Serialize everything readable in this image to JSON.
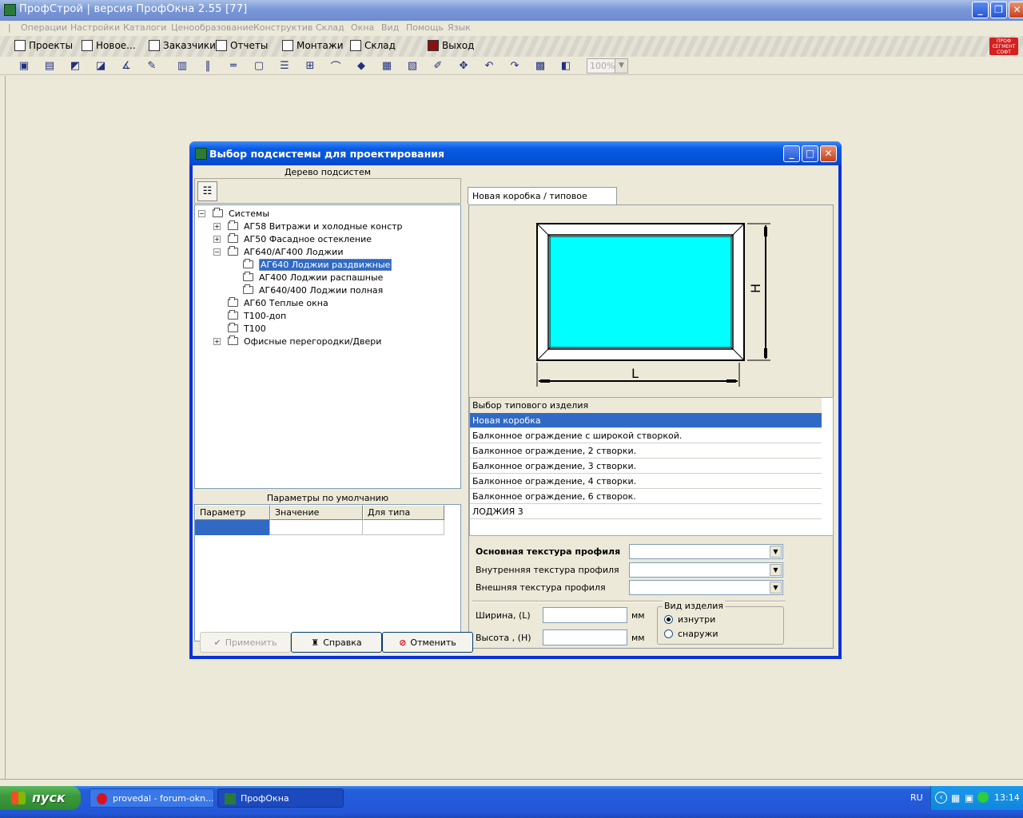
{
  "app": {
    "title": "ПрофСтрой | версия ПрофОкна  2.55 [77]"
  },
  "menu": [
    "Операции",
    "Настройки",
    "Каталоги",
    "Ценообразование",
    "Конструктив",
    "Склад",
    "Окна",
    "Вид",
    "Помощь",
    "Язык"
  ],
  "toolbar1": {
    "projects": "Проекты",
    "new": "Новое...",
    "customers": "Заказчики",
    "reports": "Отчеты",
    "installs": "Монтажи",
    "warehouse": "Склад",
    "exit": "Выход",
    "brand": [
      "ПРОФ",
      "СЕГМЕНТ",
      "СОФТ"
    ]
  },
  "toolbar2": {
    "zoom": "100%"
  },
  "dialog": {
    "title": "Выбор подсистемы для проектирования",
    "tree_header": "Дерево  подсистем",
    "tree": [
      {
        "label": "Системы",
        "level": 0,
        "expander": "−"
      },
      {
        "label": "АГ58  Витражи и холодные констр",
        "level": 1,
        "expander": "+"
      },
      {
        "label": "АГ50 Фасадное остекление",
        "level": 1,
        "expander": "+"
      },
      {
        "label": "АГ640/АГ400 Лоджии",
        "level": 1,
        "expander": "−"
      },
      {
        "label": "АГ640 Лоджии раздвижные",
        "level": 2,
        "selected": true
      },
      {
        "label": "АГ400 Лоджии распашные",
        "level": 2
      },
      {
        "label": "АГ640/400 Лоджии полная",
        "level": 2
      },
      {
        "label": "АГ60 Теплые  окна",
        "level": 1
      },
      {
        "label": "Т100-доп",
        "level": 1
      },
      {
        "label": "Т100",
        "level": 1
      },
      {
        "label": "Офисные перегородки/Двери",
        "level": 1,
        "expander": "+"
      }
    ],
    "params_header": "Параметры по умолчанию",
    "params_columns": [
      "Параметр",
      "Значение",
      "Для типа"
    ],
    "tab_label": "Новая коробка / типовое изделие",
    "preview": {
      "h_label": "H",
      "l_label": "L",
      "glass_color": "#00ffff"
    },
    "typical_header": "Выбор типового изделия",
    "typical_items": [
      "Новая коробка",
      "Балконное ограждение с широкой створкой.",
      "Балконное ограждение, 2 створки.",
      "Балконное ограждение, 3 створки.",
      "Балконное ограждение, 4 створки.",
      "Балконное ограждение, 6 створок.",
      "ЛОДЖИЯ 3"
    ],
    "selected_typical": 0,
    "texture_main_label": "Основная текстура профиля",
    "texture_inner_label": "Внутренняя  текстура профиля",
    "texture_outer_label": "Внешняя текстура профиля",
    "width_label": "Ширина, (L)",
    "height_label": "Высота , (H)",
    "unit": "мм",
    "view_group_label": "Вид изделия",
    "view_inside": "изнутри",
    "view_outside": "снаружи",
    "apply": "Применить",
    "help": "Справка",
    "cancel": "Отменить"
  },
  "taskbar": {
    "start": "пуск",
    "task1": "provedal - forum-okn...",
    "task2": "ПрофОкна",
    "lang": "RU",
    "clock": "13:14"
  }
}
